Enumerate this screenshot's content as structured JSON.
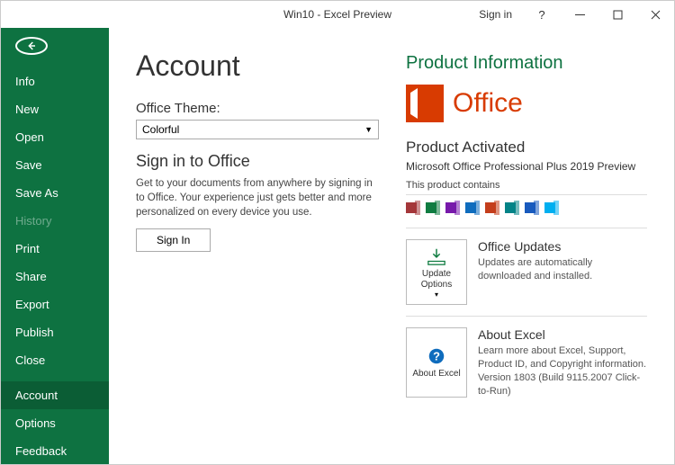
{
  "titlebar": {
    "title": "Win10 - Excel Preview",
    "signin": "Sign in"
  },
  "sidebar": {
    "items": [
      {
        "label": "Info"
      },
      {
        "label": "New"
      },
      {
        "label": "Open"
      },
      {
        "label": "Save"
      },
      {
        "label": "Save As"
      },
      {
        "label": "History",
        "dim": true
      },
      {
        "label": "Print"
      },
      {
        "label": "Share"
      },
      {
        "label": "Export"
      },
      {
        "label": "Publish"
      },
      {
        "label": "Close"
      }
    ],
    "bottom": [
      {
        "label": "Account",
        "active": true
      },
      {
        "label": "Options"
      },
      {
        "label": "Feedback"
      }
    ]
  },
  "page": {
    "title": "Account"
  },
  "theme": {
    "label": "Office Theme:",
    "value": "Colorful"
  },
  "signin_panel": {
    "title": "Sign in to Office",
    "desc": "Get to your documents from anywhere by signing in to Office.  Your experience just gets better and more personalized on every device you use.",
    "button": "Sign In"
  },
  "product": {
    "info_title": "Product Information",
    "wordmark": "Office",
    "activated": "Product Activated",
    "sku": "Microsoft Office Professional Plus 2019 Preview",
    "contains_label": "This product contains",
    "apps": [
      {
        "name": "access",
        "color": "#a4373a"
      },
      {
        "name": "excel",
        "color": "#107c41"
      },
      {
        "name": "onenote",
        "color": "#7719aa"
      },
      {
        "name": "outlook",
        "color": "#0f6cbd"
      },
      {
        "name": "powerpoint",
        "color": "#c43e1c"
      },
      {
        "name": "publisher",
        "color": "#038387"
      },
      {
        "name": "word",
        "color": "#185abd"
      },
      {
        "name": "skype",
        "color": "#00aff0"
      }
    ]
  },
  "updates": {
    "button_label": "Update Options",
    "title": "Office Updates",
    "desc": "Updates are automatically downloaded and installed."
  },
  "about": {
    "button_label": "About Excel",
    "title": "About Excel",
    "desc": "Learn more about Excel, Support, Product ID, and Copyright information.",
    "version": "Version 1803 (Build 9115.2007 Click-to-Run)"
  }
}
